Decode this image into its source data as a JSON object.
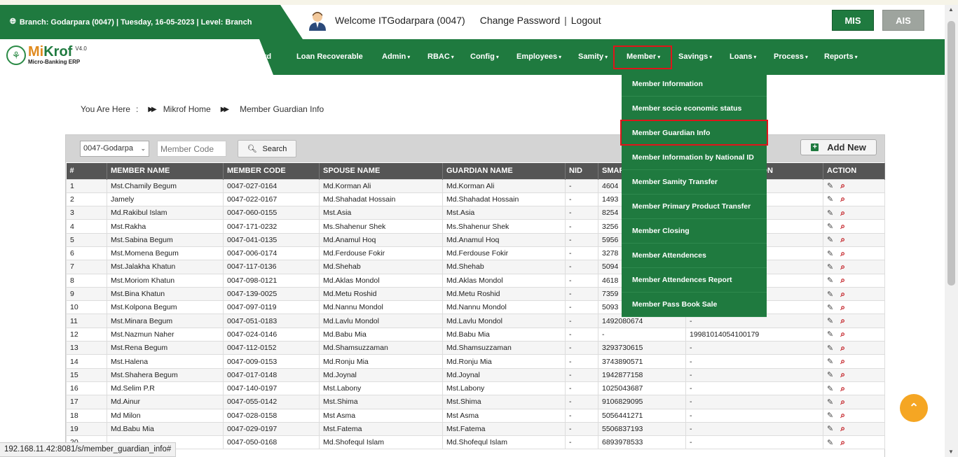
{
  "header": {
    "branch_info": "Branch: Godarpara (0047) | Tuesday, 16-05-2023 | Level: Branch",
    "welcome": "Welcome ITGodarpara (0047)",
    "change_password": "Change Password",
    "separator": "|",
    "logout": "Logout",
    "mis": "MIS",
    "ais": "AIS"
  },
  "logo": {
    "name_a": "Mi",
    "name_b": "Krof",
    "version": "V4.0",
    "subtitle": "Micro-Banking ERP"
  },
  "nav": {
    "items": [
      "ard",
      "Loan Recoverable",
      "Admin",
      "RBAC",
      "Config",
      "Employees",
      "Samity",
      "Member",
      "Savings",
      "Loans",
      "Process",
      "Reports"
    ]
  },
  "member_menu": [
    "Member Information",
    "Member socio economic status",
    "Member Guardian Info",
    "Member Information by National ID",
    "Member Samity Transfer",
    "Member Primary Product Transfer",
    "Member Closing",
    "Member Attendences",
    "Member Attendences Report",
    "Member Pass Book Sale"
  ],
  "breadcrumb": {
    "you_are_here": "You Are Here",
    "colon": ":",
    "home": "Mikrof Home",
    "current": "Member Guardian Info"
  },
  "toolbar": {
    "branch_value": "0047-Godarpa",
    "member_code_placeholder": "Member Code",
    "search_label": "Search",
    "add_new_label": "Add New"
  },
  "table": {
    "columns": [
      "#",
      "MEMBER NAME",
      "MEMBER CODE",
      "SPOUSE NAME",
      "GUARDIAN NAME",
      "NID",
      "SMART CARD",
      "BIRTH REGISTRATION",
      "ACTION"
    ],
    "rows": [
      [
        "1",
        "Mst.Chamily Begum",
        "0047-027-0164",
        "Md.Korman Ali",
        "Md.Korman Ali",
        "-",
        "4604",
        ""
      ],
      [
        "2",
        "Jamely",
        "0047-022-0167",
        "Md.Shahadat Hossain",
        "Md.Shahadat Hossain",
        "-",
        "1493",
        ""
      ],
      [
        "3",
        "Md.Rakibul Islam",
        "0047-060-0155",
        "Mst.Asia",
        "Mst.Asia",
        "-",
        "8254",
        ""
      ],
      [
        "4",
        "Mst.Rakha",
        "0047-171-0232",
        "Ms.Shahenur Shek",
        "Ms.Shahenur Shek",
        "-",
        "3256",
        ""
      ],
      [
        "5",
        "Mst.Sabina Begum",
        "0047-041-0135",
        "Md.Anamul Hoq",
        "Md.Anamul Hoq",
        "-",
        "5956",
        ""
      ],
      [
        "6",
        "Mst.Momena Begum",
        "0047-006-0174",
        "Md.Ferdouse Fokir",
        "Md.Ferdouse Fokir",
        "-",
        "3278",
        ""
      ],
      [
        "7",
        "Mst.Jalakha Khatun",
        "0047-117-0136",
        "Md.Shehab",
        "Md.Shehab",
        "-",
        "5094",
        ""
      ],
      [
        "8",
        "Mst.Moriom Khatun",
        "0047-098-0121",
        "Md.Aklas Mondol",
        "Md.Aklas Mondol",
        "-",
        "4618",
        ""
      ],
      [
        "9",
        "Mst.Bina Khatun",
        "0047-139-0025",
        "Md.Metu Roshid",
        "Md.Metu Roshid",
        "-",
        "7359",
        ""
      ],
      [
        "10",
        "Mst.Kolpona Begum",
        "0047-097-0119",
        "Md.Nannu Mondol",
        "Md.Nannu Mondol",
        "-",
        "5093",
        ""
      ],
      [
        "11",
        "Mst.Minara Begum",
        "0047-051-0183",
        "Md.Lavlu Mondol",
        "Md.Lavlu Mondol",
        "-",
        "1492080674",
        "-"
      ],
      [
        "12",
        "Mst.Nazmun Naher",
        "0047-024-0146",
        "Md.Babu Mia",
        "Md.Babu Mia",
        "-",
        "-",
        "19981014054100179"
      ],
      [
        "13",
        "Mst.Rena Begum",
        "0047-112-0152",
        "Md.Shamsuzzaman",
        "Md.Shamsuzzaman",
        "-",
        "3293730615",
        "-"
      ],
      [
        "14",
        "Mst.Halena",
        "0047-009-0153",
        "Md.Ronju Mia",
        "Md.Ronju Mia",
        "-",
        "3743890571",
        "-"
      ],
      [
        "15",
        "Mst.Shahera Begum",
        "0047-017-0148",
        "Md.Joynal",
        "Md.Joynal",
        "-",
        "1942877158",
        "-"
      ],
      [
        "16",
        "Md.Selim P.R",
        "0047-140-0197",
        "Mst.Labony",
        "Mst.Labony",
        "-",
        "1025043687",
        "-"
      ],
      [
        "17",
        "Md.Ainur",
        "0047-055-0142",
        "Mst.Shima",
        "Mst.Shima",
        "-",
        "9106829095",
        "-"
      ],
      [
        "18",
        "Md Milon",
        "0047-028-0158",
        "Mst Asma",
        "Mst Asma",
        "-",
        "5056441271",
        "-"
      ],
      [
        "19",
        "Md.Babu Mia",
        "0047-029-0197",
        "Mst.Fatema",
        "Mst.Fatema",
        "-",
        "5506837193",
        "-"
      ],
      [
        "20",
        "",
        "0047-050-0168",
        "Md.Shofequl Islam",
        "Md.Shofequl Islam",
        "-",
        "6893978533",
        "-"
      ]
    ]
  },
  "status_url": "192.168.11.42:8081/s/member_guardian_info#",
  "colors": {
    "brand_green": "#1f7a3f",
    "highlight_red": "#e0141a",
    "back_to_top": "#f5a623"
  }
}
